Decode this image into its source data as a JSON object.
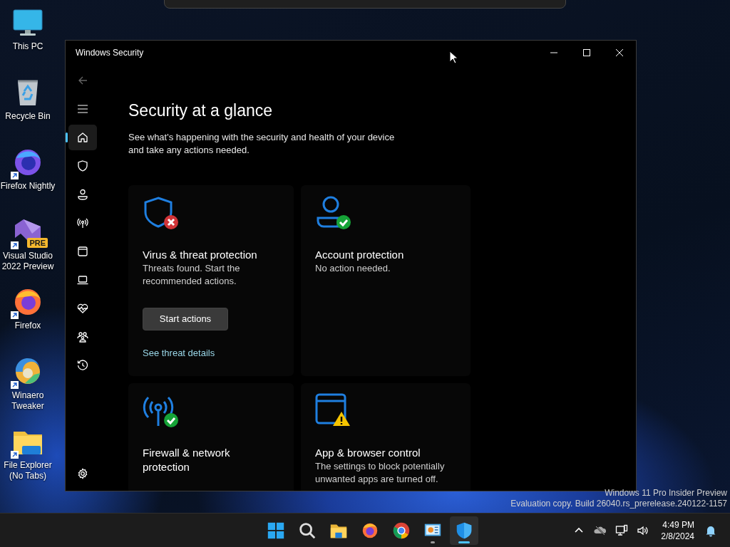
{
  "desktop_icons": [
    {
      "kind": "pc",
      "label": "This PC",
      "shortcut": false
    },
    {
      "kind": "recycle",
      "label": "Recycle Bin",
      "shortcut": false
    },
    {
      "kind": "firefox-nightly",
      "label": "Firefox Nightly",
      "shortcut": true
    },
    {
      "kind": "visual-studio",
      "label": "Visual Studio 2022 Preview",
      "badge": "PRE",
      "shortcut": true
    },
    {
      "kind": "firefox",
      "label": "Firefox",
      "shortcut": true
    },
    {
      "kind": "winaero",
      "label": "Winaero Tweaker",
      "shortcut": true
    },
    {
      "kind": "folder",
      "label": "File Explorer (No Tabs)",
      "shortcut": true
    }
  ],
  "window": {
    "title": "Windows Security",
    "nav": [
      {
        "kind": "home",
        "selected": true
      },
      {
        "kind": "shield",
        "selected": false
      },
      {
        "kind": "person",
        "selected": false
      },
      {
        "kind": "antenna",
        "selected": false
      },
      {
        "kind": "browser",
        "selected": false
      },
      {
        "kind": "laptop",
        "selected": false
      },
      {
        "kind": "heart",
        "selected": false
      },
      {
        "kind": "family",
        "selected": false
      },
      {
        "kind": "history",
        "selected": false
      }
    ],
    "heading": "Security at a glance",
    "subtitle": "See what's happening with the security and health of your device and take any actions needed.",
    "cards": [
      {
        "kind": "shield-error",
        "title": "Virus & threat protection",
        "description": "Threats found. Start the recommended actions.",
        "button": "Start actions",
        "link": "See threat details"
      },
      {
        "kind": "person-ok",
        "title": "Account protection",
        "description": "No action needed."
      },
      {
        "kind": "antenna-ok",
        "title": "Firewall & network protection"
      },
      {
        "kind": "browser-warning",
        "title": "App & browser control",
        "description": "The settings to block potentially unwanted apps are turned off."
      }
    ]
  },
  "watermark": [
    "Windows 11 Pro Insider Preview",
    "Evaluation copy. Build 26040.rs_prerelease.240122-1157"
  ],
  "taskbar": {
    "apps": [
      {
        "kind": "start",
        "running": false,
        "selected": false
      },
      {
        "kind": "search",
        "running": false,
        "selected": false
      },
      {
        "kind": "folder",
        "running": false,
        "selected": false
      },
      {
        "kind": "firefox",
        "running": false,
        "selected": false
      },
      {
        "kind": "chrome",
        "running": false,
        "selected": false
      },
      {
        "kind": "control-panel",
        "running": true,
        "selected": false
      },
      {
        "kind": "security",
        "running": true,
        "selected": true
      }
    ],
    "time": "4:49 PM",
    "date": "2/8/2024"
  }
}
